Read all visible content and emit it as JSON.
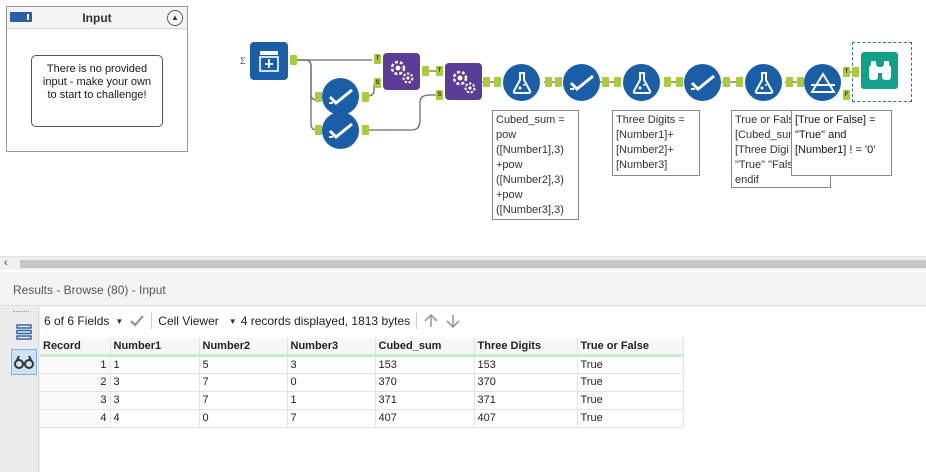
{
  "input_panel": {
    "title": "Input",
    "message": "There is no provided input - make your own to start to challenge!"
  },
  "anchors": {
    "true": "T",
    "false": "F",
    "source": "S"
  },
  "annotations": {
    "cubed_sum": "Cubed_sum = pow ([Number1],3) +pow ([Number2],3) +pow ([Number3],3)",
    "three_digits": "Three Digits = [Number1]+ [Number2]+ [Number3]",
    "true_or_false_back": "True or False [Cubed_sum [Three Digi then \"True\" \"False\" endif",
    "true_or_false_front": "[True or False] = \"True\" and [Number1] ! = '0'"
  },
  "results": {
    "title": "Results - Browse (80) - Input",
    "fields_label": "6 of 6 Fields",
    "viewer_label": "Cell Viewer",
    "status": "4 records displayed, 1813 bytes",
    "columns": [
      "Record",
      "Number1",
      "Number2",
      "Number3",
      "Cubed_sum",
      "Three Digits",
      "True or False"
    ],
    "rows": [
      [
        "1",
        "1",
        "5",
        "3",
        "153",
        "153",
        "True"
      ],
      [
        "2",
        "3",
        "7",
        "0",
        "370",
        "370",
        "True"
      ],
      [
        "3",
        "3",
        "7",
        "1",
        "371",
        "371",
        "True"
      ],
      [
        "4",
        "4",
        "0",
        "7",
        "407",
        "407",
        "True"
      ]
    ]
  },
  "colors": {
    "tool_blue": "#1b5ea8",
    "tool_purple": "#5b3c96",
    "tool_teal": "#11a089",
    "anchor_green": "#a9cc3d"
  }
}
